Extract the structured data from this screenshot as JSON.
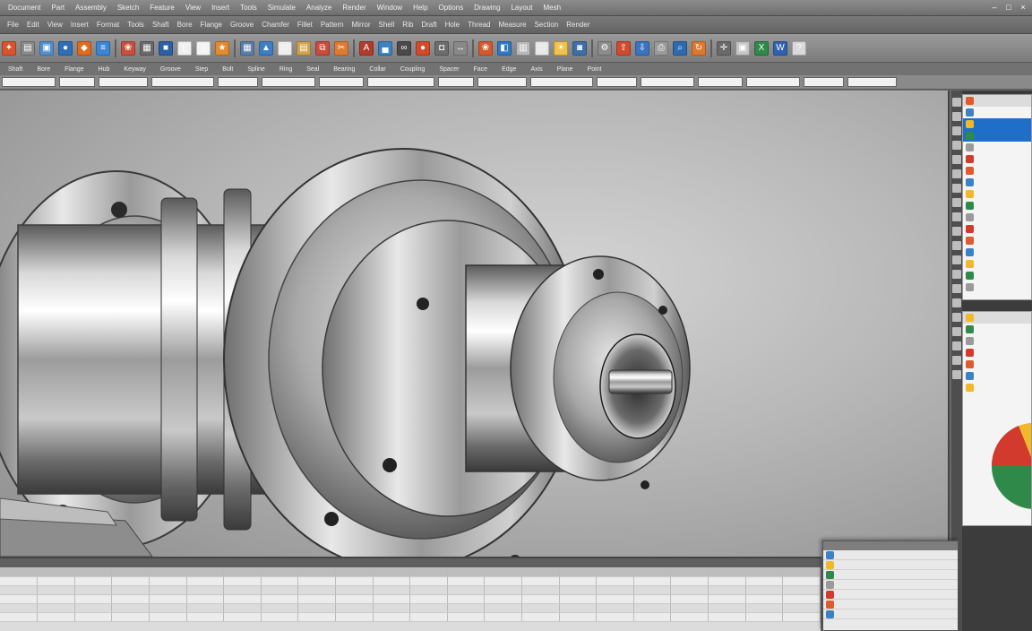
{
  "window": {
    "menu": [
      "Document",
      "Part",
      "Assembly",
      "Sketch",
      "Feature",
      "View",
      "Insert",
      "Tools",
      "Simulate",
      "Analyze",
      "Render",
      "Window",
      "Help",
      "Options",
      "Drawing",
      "Layout",
      "Mesh"
    ],
    "controls": [
      "–",
      "□",
      "×"
    ]
  },
  "menu_row2": [
    "File",
    "Edit",
    "View",
    "Insert",
    "Format",
    "Tools",
    "Shaft",
    "Bore",
    "Flange",
    "Groove",
    "Chamfer",
    "Fillet",
    "Pattern",
    "Mirror",
    "Shell",
    "Rib",
    "Draft",
    "Hole",
    "Thread",
    "Measure",
    "Section",
    "Render"
  ],
  "toolbar": {
    "icons": [
      {
        "name": "new-icon",
        "color": "#d9532c",
        "glyph": "✦"
      },
      {
        "name": "open-icon",
        "color": "#8a8a8a",
        "glyph": "▤"
      },
      {
        "name": "image-icon",
        "color": "#4f8fd0",
        "glyph": "▣"
      },
      {
        "name": "globe-icon",
        "color": "#2f6fb8",
        "glyph": "●"
      },
      {
        "name": "render-icon",
        "color": "#e06a1e",
        "glyph": "◆"
      },
      {
        "name": "layers-icon",
        "color": "#3a86d4",
        "glyph": "≡"
      },
      {
        "name": "palette-icon",
        "color": "#c94f3a",
        "glyph": "❀"
      },
      {
        "name": "table-icon",
        "color": "#6a6a6a",
        "glyph": "▦"
      },
      {
        "name": "save-icon",
        "color": "#2b5fa8",
        "glyph": "■"
      },
      {
        "name": "document-icon",
        "color": "#f0f0f0",
        "glyph": "▯"
      },
      {
        "name": "page-icon",
        "color": "#f3f3f3",
        "glyph": "▯"
      },
      {
        "name": "star-icon",
        "color": "#e38a2c",
        "glyph": "★"
      },
      {
        "name": "grid-icon",
        "color": "#5a7ea8",
        "glyph": "▦"
      },
      {
        "name": "shape-icon",
        "color": "#3d7fc7",
        "glyph": "▲"
      },
      {
        "name": "sheet-icon",
        "color": "#eeeeee",
        "glyph": "□"
      },
      {
        "name": "paste-icon",
        "color": "#d0a24a",
        "glyph": "▤"
      },
      {
        "name": "copy-icon",
        "color": "#cc4a3a",
        "glyph": "⧉"
      },
      {
        "name": "cut-icon",
        "color": "#e07a2e",
        "glyph": "✂"
      },
      {
        "name": "font-icon",
        "color": "#b23a2e",
        "glyph": "A"
      },
      {
        "name": "chart-icon",
        "color": "#3b82c4",
        "glyph": "▄"
      },
      {
        "name": "link-icon",
        "color": "#4a4a4a",
        "glyph": "∞"
      },
      {
        "name": "pin-icon",
        "color": "#d24a2a",
        "glyph": "●"
      },
      {
        "name": "camera-icon",
        "color": "#6d6d6d",
        "glyph": "◘"
      },
      {
        "name": "measure-icon",
        "color": "#888888",
        "glyph": "↔"
      },
      {
        "name": "palette2-icon",
        "color": "#d45a2e",
        "glyph": "❀"
      },
      {
        "name": "section-icon",
        "color": "#2e78c4",
        "glyph": "◧"
      },
      {
        "name": "materials-icon",
        "color": "#b9b9b9",
        "glyph": "▥"
      },
      {
        "name": "window-icon",
        "color": "#e8e8e8",
        "glyph": "□"
      },
      {
        "name": "lights-icon",
        "color": "#f1c24a",
        "glyph": "☀"
      },
      {
        "name": "camera2-icon",
        "color": "#3d6fa8",
        "glyph": "◙"
      },
      {
        "name": "gear-icon",
        "color": "#8c8c8c",
        "glyph": "⚙"
      },
      {
        "name": "export-icon",
        "color": "#d04a2e",
        "glyph": "⇧"
      },
      {
        "name": "import-icon",
        "color": "#3874c0",
        "glyph": "⇩"
      },
      {
        "name": "print-icon",
        "color": "#9a9a9a",
        "glyph": "⎙"
      },
      {
        "name": "zoom-icon",
        "color": "#2c6bb0",
        "glyph": "⌕"
      },
      {
        "name": "rotate-icon",
        "color": "#e0782c",
        "glyph": "↻"
      },
      {
        "name": "pan-icon",
        "color": "#6a6a6a",
        "glyph": "✛"
      },
      {
        "name": "fit-icon",
        "color": "#c4c4c4",
        "glyph": "▣"
      },
      {
        "name": "excel-icon",
        "color": "#2f8a4a",
        "glyph": "X"
      },
      {
        "name": "word-icon",
        "color": "#2f62b0",
        "glyph": "W"
      },
      {
        "name": "help-icon",
        "color": "#d9d9d9",
        "glyph": "?"
      }
    ]
  },
  "prop_row": [
    "Shaft",
    "Bore",
    "Flange",
    "Hub",
    "Keyway",
    "Groove",
    "Step",
    "Bolt",
    "Spline",
    "Ring",
    "Seal",
    "Bearing",
    "Collar",
    "Coupling",
    "Spacer",
    "Face",
    "Edge",
    "Axis",
    "Plane",
    "Point"
  ],
  "field_row": [
    "",
    "",
    "",
    "",
    "",
    "",
    "",
    "",
    "",
    "",
    "",
    "",
    "",
    "",
    "",
    "",
    ""
  ],
  "right_panel": {
    "card1_rows": [
      "",
      "",
      "",
      "",
      "",
      "",
      "",
      "",
      "",
      "",
      "",
      "",
      "",
      "",
      "",
      "",
      ""
    ],
    "card2_rows": [
      "",
      "",
      "",
      "",
      "",
      "",
      ""
    ]
  },
  "bottom_table": {
    "header": [
      "",
      "",
      "",
      "",
      "",
      "",
      "",
      "",
      "",
      "",
      "",
      "",
      ""
    ],
    "columns": [
      "",
      "",
      "",
      "",
      "",
      "",
      "",
      "",
      "",
      "",
      "",
      "",
      "",
      "",
      "",
      "",
      "",
      "",
      "",
      "",
      "",
      ""
    ],
    "rows": [
      [
        "",
        "",
        "",
        "",
        "",
        "",
        "",
        "",
        "",
        "",
        "",
        "",
        "",
        "",
        "",
        "",
        "",
        "",
        "",
        "",
        "",
        ""
      ],
      [
        "",
        "",
        "",
        "",
        "",
        "",
        "",
        "",
        "",
        "",
        "",
        "",
        "",
        "",
        "",
        "",
        "",
        "",
        "",
        "",
        "",
        ""
      ],
      [
        "",
        "",
        "",
        "",
        "",
        "",
        "",
        "",
        "",
        "",
        "",
        "",
        "",
        "",
        "",
        "",
        "",
        "",
        "",
        "",
        "",
        ""
      ],
      [
        "",
        "",
        "",
        "",
        "",
        "",
        "",
        "",
        "",
        "",
        "",
        "",
        "",
        "",
        "",
        "",
        "",
        "",
        "",
        "",
        "",
        ""
      ],
      [
        "",
        "",
        "",
        "",
        "",
        "",
        "",
        "",
        "",
        "",
        "",
        "",
        "",
        "",
        "",
        "",
        "",
        "",
        "",
        "",
        "",
        ""
      ]
    ]
  },
  "dialog": {
    "title": "",
    "rows": [
      "",
      "",
      "",
      "",
      "",
      "",
      ""
    ]
  },
  "colors": {
    "accent": "#1f6fc9",
    "toolbar": "#8a8a8a",
    "metal_light": "#f2f2f2",
    "metal_dark": "#4a4a4a"
  }
}
